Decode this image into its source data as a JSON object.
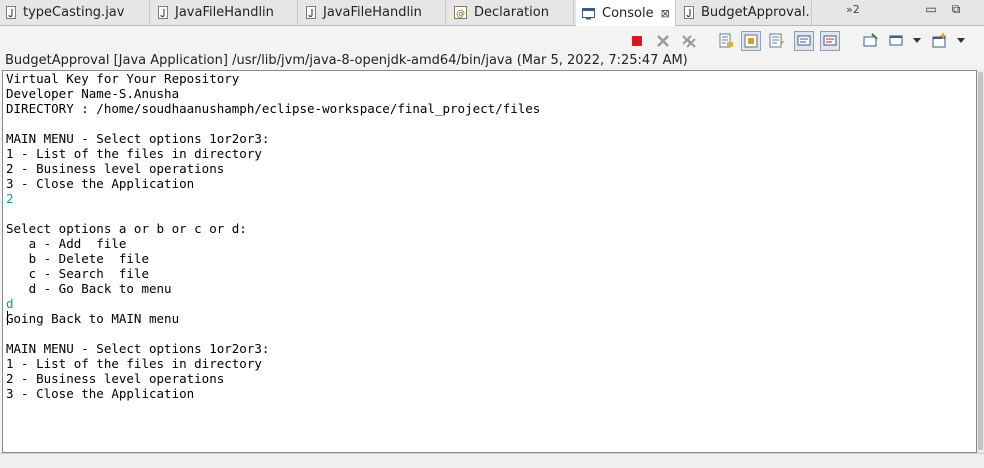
{
  "tabs": [
    {
      "label": "typeCasting.jav",
      "icon": "java-file-icon",
      "active": false
    },
    {
      "label": "JavaFileHandlin",
      "icon": "java-file-icon",
      "active": false
    },
    {
      "label": "JavaFileHandlin",
      "icon": "java-file-icon",
      "active": false
    },
    {
      "label": "Declaration",
      "icon": "declaration-icon",
      "active": false
    },
    {
      "label": "Console",
      "icon": "console-icon",
      "active": true,
      "close": "⊠"
    },
    {
      "label": "BudgetApproval.",
      "icon": "java-file-icon",
      "active": false
    }
  ],
  "overflow": {
    "label": "»2"
  },
  "window_controls": {
    "minimize": "▭",
    "restore": "⧉"
  },
  "toolbar": {
    "buttons": [
      "terminate-icon",
      "remove-launch-icon",
      "remove-all-terminated-icon",
      "clear-console-icon",
      "scroll-lock-icon",
      "word-wrap-icon",
      "show-stdout-icon",
      "show-stderr-icon",
      "pin-console-icon",
      "display-selected-console-icon",
      "open-console-icon"
    ],
    "terminate_color": "#d9161c"
  },
  "process_label": "BudgetApproval [Java Application] /usr/lib/jvm/java-8-openjdk-amd64/bin/java (Mar 5, 2022, 7:25:47 AM)",
  "console": {
    "input_color": "#10a08a",
    "lines": [
      {
        "text": "Virtual Key for Your Repository",
        "input": false
      },
      {
        "text": "Developer Name-S.Anusha",
        "input": false
      },
      {
        "text": "DIRECTORY : /home/soudhaanushamph/eclipse-workspace/final_project/files",
        "input": false
      },
      {
        "text": "",
        "input": false
      },
      {
        "text": "MAIN MENU - Select options 1or2or3:",
        "input": false
      },
      {
        "text": "1 - List of the files in directory",
        "input": false
      },
      {
        "text": "2 - Business level operations",
        "input": false
      },
      {
        "text": "3 - Close the Application",
        "input": false
      },
      {
        "text": "2",
        "input": true
      },
      {
        "text": "",
        "input": false
      },
      {
        "text": "Select options a or b or c or d:",
        "input": false
      },
      {
        "text": "   a - Add  file",
        "input": false
      },
      {
        "text": "   b - Delete  file",
        "input": false
      },
      {
        "text": "   c - Search  file",
        "input": false
      },
      {
        "text": "   d - Go Back to menu",
        "input": false
      },
      {
        "text": "d",
        "input": true
      },
      {
        "text": "Going Back to MAIN menu",
        "input": false
      },
      {
        "text": "",
        "input": false
      },
      {
        "text": "MAIN MENU - Select options 1or2or3:",
        "input": false
      },
      {
        "text": "1 - List of the files in directory",
        "input": false
      },
      {
        "text": "2 - Business level operations",
        "input": false
      },
      {
        "text": "3 - Close the Application",
        "input": false
      }
    ]
  }
}
